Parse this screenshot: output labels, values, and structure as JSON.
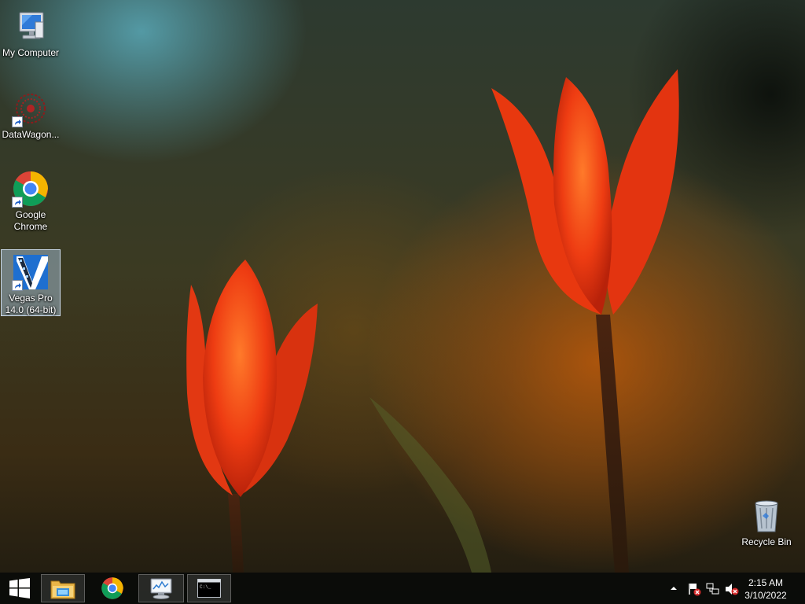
{
  "desktop": {
    "icons": [
      {
        "label": "My Computer",
        "icon": "computer-icon"
      },
      {
        "label": "DataWagon...",
        "icon": "datawagon-icon"
      },
      {
        "label": "Google Chrome",
        "icon": "chrome-icon"
      },
      {
        "label": "Vegas Pro 14.0 (64-bit)",
        "icon": "vegas-pro-icon"
      },
      {
        "label": "Recycle Bin",
        "icon": "recycle-bin-icon"
      }
    ]
  },
  "taskbar": {
    "buttons": [
      {
        "icon": "start-windows-icon"
      },
      {
        "icon": "file-explorer-icon"
      },
      {
        "icon": "chrome-icon"
      },
      {
        "icon": "performance-monitor-icon"
      },
      {
        "icon": "command-prompt-icon"
      }
    ],
    "tray": {
      "icons": [
        "show-hidden-icons-chevron",
        "action-center-flag-icon",
        "network-icon",
        "volume-muted-icon"
      ]
    },
    "clock": {
      "time": "2:15 AM",
      "date": "3/10/2022"
    }
  }
}
